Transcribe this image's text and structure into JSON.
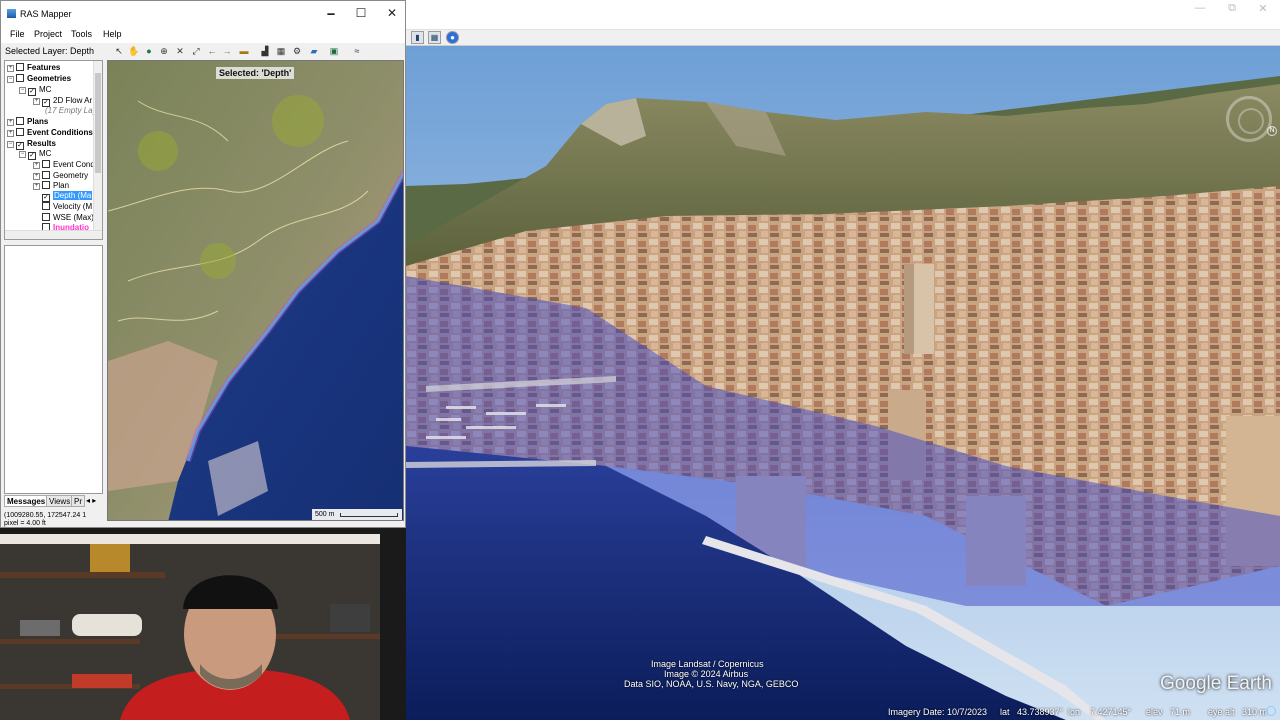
{
  "ras_mapper": {
    "window_title": "RAS Mapper",
    "window_controls": {
      "minimize": "🗕",
      "maximize": "☐",
      "close": "✕"
    },
    "menu": [
      "File",
      "Project",
      "Tools",
      "Help"
    ],
    "selected_layer_label": "Selected Layer: Depth",
    "tree": {
      "features": "Features",
      "geometries": "Geometries",
      "geom_mc": "MC",
      "flow_area": "2D Flow Ar",
      "empty_layers": "(17 Empty Lay",
      "plans": "Plans",
      "event_conditions": "Event Conditions",
      "results": "Results",
      "results_mc": "MC",
      "event_cond": "Event Cond",
      "geometry": "Geometry",
      "plan": "Plan",
      "depth": "Depth (Ma",
      "velocity": "Velocity (M",
      "wse": "WSE (Max)",
      "inundation": "Inundatio"
    },
    "tabs": [
      "Messages",
      "Views",
      "Pr"
    ],
    "coordinates_line1": "(1009280.55, 172547.24  1",
    "coordinates_line2": "pixel = 4.00 ft",
    "map": {
      "selected_label": "Selected: 'Depth'",
      "scale": "500 m"
    }
  },
  "google_earth": {
    "attribution": [
      "Image Landsat / Copernicus",
      "Image © 2024 Airbus",
      "Data SIO, NOAA, U.S. Navy, NGA, GEBCO"
    ],
    "logo": "Google Earth",
    "status": {
      "imagery_date": "Imagery Date: 10/7/2023",
      "lat_label": "lat",
      "lat": "43.738937°",
      "lon_label": "lon",
      "lon": "7.427145°",
      "elev_label": "elev",
      "elev": "71 m",
      "eye_alt_label": "eye alt",
      "eye_alt": "310 m"
    },
    "window_controls": {
      "minimize": "—",
      "maximize": "⧉",
      "close": "✕"
    }
  },
  "colors": {
    "depth_overlay": "#3c46c8",
    "sea": "#0e2c78",
    "sky": "#a8c8ec"
  }
}
